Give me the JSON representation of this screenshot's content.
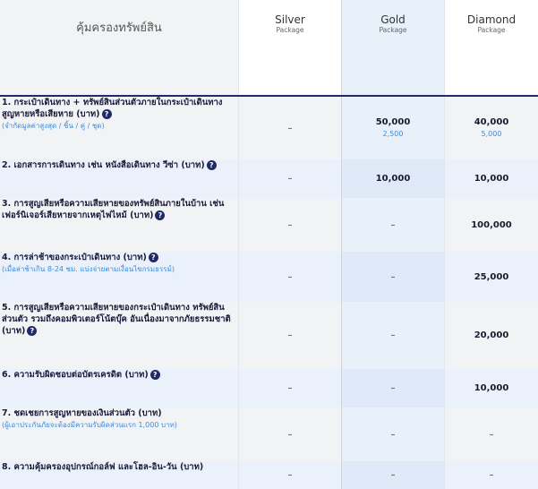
{
  "header": {
    "title": "คุ้มครองทรัพย์สิน",
    "packages": [
      {
        "name": "Silver",
        "sub": "Package"
      },
      {
        "name": "Gold",
        "sub": "Package"
      },
      {
        "name": "Diamond",
        "sub": "Package"
      }
    ]
  },
  "rows": [
    {
      "label": "1. กระเป๋าเดินทาง + ทรัพย์สินส่วนตัวภายในกระเป๋าเดินทาง สูญหายหรือเสียหาย (บาท)",
      "sub": "(จำกัดมูลค่าสูงสุด / ชิ้น / คู่ / ชุด)",
      "silver": "–",
      "gold": "50,000",
      "gold_sub": "2,500",
      "diamond": "40,000",
      "diamond_sub": "5,000"
    },
    {
      "label": "2. เอกสารการเดินทาง เช่น หนังสือเดินทาง วีซ่า (บาท)",
      "sub": "",
      "silver": "–",
      "gold": "10,000",
      "gold_sub": "",
      "diamond": "10,000",
      "diamond_sub": ""
    },
    {
      "label": "3. การสูญเสียหรือความเสียหายของทรัพย์สินภายในบ้าน เช่น เฟอร์นิเจอร์เสียหายจากเหตุไฟไหม้ (บาท)",
      "sub": "",
      "silver": "–",
      "gold": "–",
      "gold_sub": "",
      "diamond": "100,000",
      "diamond_sub": ""
    },
    {
      "label": "4. การล่าช้าของกระเป๋าเดินทาง (บาท)",
      "sub": "(เมื่อล่าช้าเกิน 8-24 ชม. แบ่งจ่ายตามเงื่อนไขกรมธรรม์)",
      "silver": "–",
      "gold": "–",
      "gold_sub": "",
      "diamond": "25,000",
      "diamond_sub": ""
    },
    {
      "label": "5. การสูญเสียหรือความเสียหายของกระเป๋าเดินทาง ทรัพย์สินส่วนตัว รวมถึงคอมพิวเตอร์โน้ตบุ๊ค อันเนื่องมาจากภัยธรรมชาติ (บาท)",
      "sub": "",
      "silver": "–",
      "gold": "–",
      "gold_sub": "",
      "diamond": "20,000",
      "diamond_sub": ""
    },
    {
      "label": "6. ความรับผิดชอบต่อบัตรเครดิต (บาท)",
      "sub": "",
      "silver": "–",
      "gold": "–",
      "gold_sub": "",
      "diamond": "10,000",
      "diamond_sub": ""
    },
    {
      "label": "7. ชดเชยการสูญหายของเงินส่วนตัว (บาท)",
      "sub": "(ผู้เอาประกันภัยจะต้องมีความรับผิดส่วนแรก 1,000 บาท)",
      "silver": "–",
      "gold": "–",
      "gold_sub": "",
      "diamond": "–",
      "diamond_sub": ""
    },
    {
      "label": "8. ความคุ้มครองอุปกรณ์กอล์ฟ และโฮล-อิน-วัน (บาท)",
      "sub": "",
      "silver": "–",
      "gold": "–",
      "gold_sub": "",
      "diamond": "–",
      "diamond_sub": ""
    }
  ]
}
